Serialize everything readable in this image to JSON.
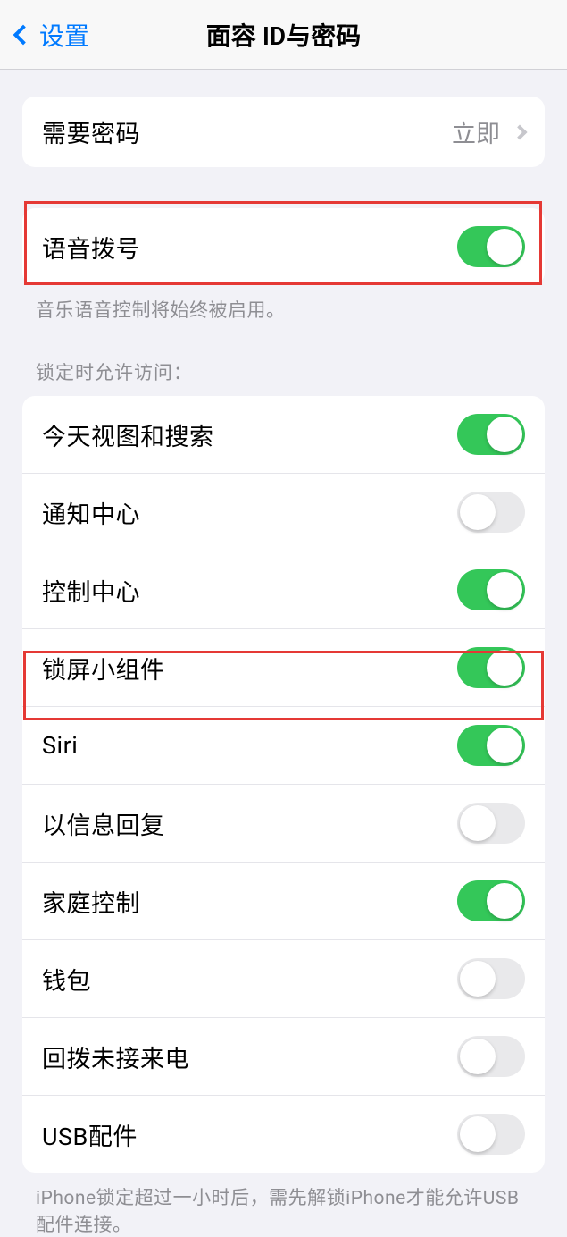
{
  "nav": {
    "back_label": "设置",
    "title": "面容 ID与密码"
  },
  "require_passcode": {
    "label": "需要密码",
    "value": "立即"
  },
  "voice_dial": {
    "label": "语音拨号",
    "on": true,
    "footer": "音乐语音控制将始终被启用。"
  },
  "lock_access": {
    "header": "锁定时允许访问：",
    "items": [
      {
        "label": "今天视图和搜索",
        "on": true
      },
      {
        "label": "通知中心",
        "on": false
      },
      {
        "label": "控制中心",
        "on": true
      },
      {
        "label": "锁屏小组件",
        "on": true
      },
      {
        "label": "Siri",
        "on": true
      },
      {
        "label": "以信息回复",
        "on": false
      },
      {
        "label": "家庭控制",
        "on": true
      },
      {
        "label": "钱包",
        "on": false
      },
      {
        "label": "回拨未接来电",
        "on": false
      },
      {
        "label": "USB配件",
        "on": false
      }
    ],
    "footer": "iPhone锁定超过一小时后，需先解锁iPhone才能允许USB 配件连接。"
  }
}
